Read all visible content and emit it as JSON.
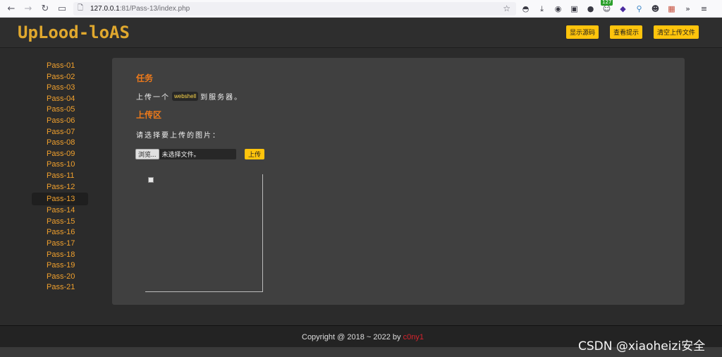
{
  "browser": {
    "url_host": "127.0.0.1",
    "url_rest": ":81/Pass-13/index.php",
    "badge_count": "127"
  },
  "header": {
    "logo_text": "UpLood-loAS",
    "buttons": [
      "显示源码",
      "查看提示",
      "清空上传文件"
    ]
  },
  "sidebar": {
    "items": [
      "Pass-01",
      "Pass-02",
      "Pass-03",
      "Pass-04",
      "Pass-05",
      "Pass-06",
      "Pass-07",
      "Pass-08",
      "Pass-09",
      "Pass-10",
      "Pass-11",
      "Pass-12",
      "Pass-13",
      "Pass-14",
      "Pass-15",
      "Pass-16",
      "Pass-17",
      "Pass-18",
      "Pass-19",
      "Pass-20",
      "Pass-21"
    ],
    "active_index": 12
  },
  "main": {
    "task_heading": "任务",
    "task_prefix": "上传一个",
    "task_code": "webshell",
    "task_suffix": "到服务器。",
    "upload_heading": "上传区",
    "choose_label": "请选择要上传的图片：",
    "browse_label": "浏览...",
    "no_file_label": "未选择文件。",
    "upload_button": "上传"
  },
  "footer": {
    "copyright_prefix": "Copyright @ 2018 ~ 2022 by ",
    "author": "c0ny1"
  },
  "watermark": "CSDN @xiaoheizi安全",
  "colors": {
    "accent": "#ffc40c",
    "heading": "#ef7a1a",
    "sidebar_link": "#f0a02d",
    "author": "#d9232d"
  }
}
